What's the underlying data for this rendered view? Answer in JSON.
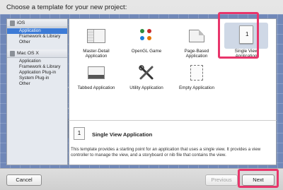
{
  "header": {
    "title": "Choose a template for your new project:"
  },
  "sidebar": {
    "groups": [
      {
        "name": "iOS",
        "icon": "ios-device-icon",
        "items": [
          {
            "label": "Application",
            "selected": true
          },
          {
            "label": "Framework & Library"
          },
          {
            "label": "Other"
          }
        ]
      },
      {
        "name": "Mac OS X",
        "icon": "mac-os-x-icon",
        "items": [
          {
            "label": "Application"
          },
          {
            "label": "Framework & Library"
          },
          {
            "label": "Application Plug-in"
          },
          {
            "label": "System Plug-in"
          },
          {
            "label": "Other"
          }
        ]
      }
    ]
  },
  "templates": [
    {
      "label": "Master-Detail Application",
      "icon": "master-detail-icon"
    },
    {
      "label": "OpenGL Game",
      "icon": "opengl-icon"
    },
    {
      "label": "Page-Based Application",
      "icon": "page-based-icon"
    },
    {
      "label": "Single View Application",
      "icon": "single-view-icon",
      "badge": "1",
      "selected": true
    },
    {
      "label": "Tabbed Application",
      "icon": "tabbed-icon"
    },
    {
      "label": "Utility Application",
      "icon": "utility-icon"
    },
    {
      "label": "Empty Application",
      "icon": "empty-app-icon"
    }
  ],
  "description": {
    "badge": "1",
    "title": "Single View Application",
    "text": "This template provides a starting point for an application that uses a single view. It provides a view controller to manage the view, and a storyboard or nib file that contains the view."
  },
  "buttons": {
    "cancel": "Cancel",
    "previous": "Previous",
    "next": "Next"
  },
  "colors": {
    "selection": "#3d7bd6",
    "highlight": "#e8356b",
    "blueprint": "#6f87b8"
  }
}
